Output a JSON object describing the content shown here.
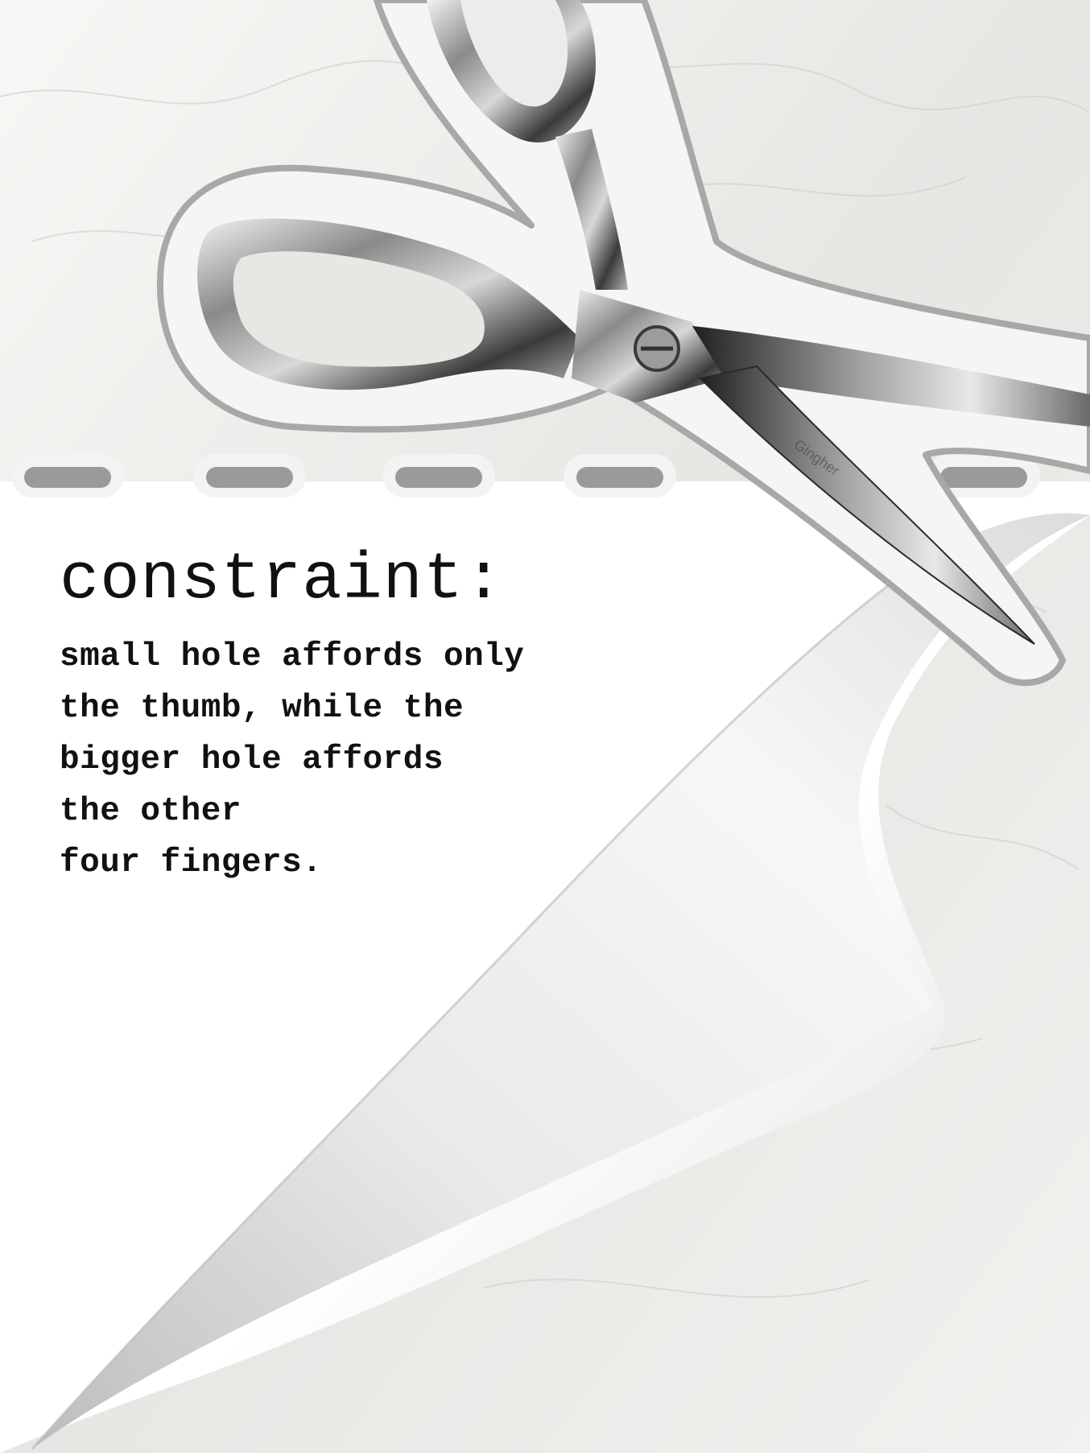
{
  "heading": "constraint:",
  "body_text": "small hole affords only\nthe thumb, while the\nbigger hole affords\nthe other\nfour fingers.",
  "scissors_brand_text": "Gingher",
  "colors": {
    "paper": "#f4f4f2",
    "page": "#ffffff",
    "curl_shadow": "#cfcfcf",
    "binder_hole": "#9a9a9a",
    "steel_dark": "#2a2a2a",
    "steel_light": "#d9d9d9",
    "text": "#111111"
  },
  "icons": [
    "scissors-icon",
    "binder-hole-icon",
    "page-curl-icon"
  ]
}
